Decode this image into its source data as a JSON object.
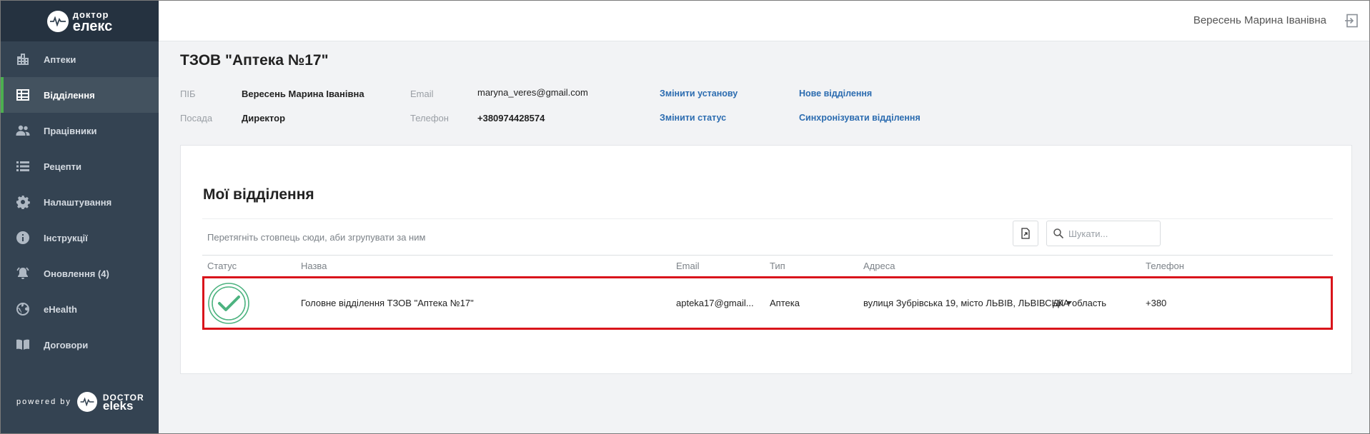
{
  "brand": {
    "logo_line1": "доктор",
    "logo_line2": "елекс",
    "powered_by": "powered by",
    "footer_logo_line1": "DOCTOR",
    "footer_logo_line2": "eleks",
    "accent_color": "#4caf50"
  },
  "sidebar": {
    "items": [
      {
        "label": "Аптеки",
        "icon": "building-icon"
      },
      {
        "label": "Відділення",
        "icon": "departments-icon",
        "active": true
      },
      {
        "label": "Працівники",
        "icon": "people-icon"
      },
      {
        "label": "Рецепти",
        "icon": "list-icon"
      },
      {
        "label": "Налаштування",
        "icon": "gear-icon"
      },
      {
        "label": "Інструкції",
        "icon": "info-icon"
      },
      {
        "label": "Оновлення (4)",
        "icon": "bell-icon"
      },
      {
        "label": "eHealth",
        "icon": "globe-icon"
      },
      {
        "label": "Договори",
        "icon": "book-icon"
      }
    ]
  },
  "topbar": {
    "user_name": "Вересень Марина Іванівна",
    "logout_icon": "logout-icon"
  },
  "header": {
    "company": "ТЗОВ \"Аптека №17\"",
    "fields": {
      "pib_label": "ПІБ",
      "pib_value": "Вересень Марина Іванівна",
      "position_label": "Посада",
      "position_value": "Директор",
      "email_label": "Email",
      "email_value": "maryna_veres@gmail.com",
      "phone_label": "Телефон",
      "phone_value": "+380974428574"
    },
    "actions": {
      "change_institution": "Змінити установу",
      "change_status": "Змінити статус",
      "new_department": "Нове відділення",
      "sync_departments": "Синхронізувати відділення"
    }
  },
  "panel": {
    "title": "Мої відділення",
    "group_hint": "Перетягніть стовпець сюди, аби згрупувати за ним",
    "search_placeholder": "Шукати...",
    "columns": {
      "status": "Статус",
      "name": "Назва",
      "email": "Email",
      "type": "Тип",
      "address": "Адреса",
      "phone": "Телефон"
    },
    "rows": [
      {
        "status": "active",
        "name": "Головне відділення ТЗОВ \"Аптека №17\"",
        "email": "apteka17@gmail...",
        "type": "Аптека",
        "address": "вулиця Зубрівська 19, місто ЛЬВІВ, ЛЬВІВСЬКА область",
        "phone": "+380",
        "actions_label": "Дії"
      }
    ]
  }
}
